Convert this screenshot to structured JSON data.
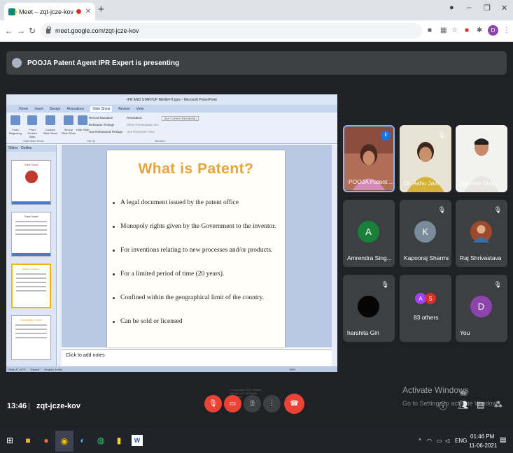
{
  "browser": {
    "tab_title": "Meet – zqt-jcze-kov",
    "close_tab": "✕",
    "new_tab": "+",
    "url": "meet.google.com/zqt-jcze-kov",
    "profile_initial": "D",
    "window_controls": [
      "–",
      "❐",
      "✕"
    ]
  },
  "banner": {
    "text": "POOJA Patent Agent IPR Expert is presenting"
  },
  "presentation": {
    "window_title": "IPR AND STARTUP BENEFIT.pptx - Microsoft PowerPoint",
    "ribbon_tabs": [
      "Home",
      "Insert",
      "Design",
      "Animations",
      "Slide Show",
      "Review",
      "View"
    ],
    "ribbon_buttons": [
      "From Beginning",
      "From Current Slide",
      "Custom Slide Show",
      "Set Up Slide Show",
      "Hide Slide"
    ],
    "ribbon_options": [
      "Record Narration",
      "Rehearse Timings",
      "Use Rehearsed Timings",
      "Resolution:",
      "Use Current Resolution",
      "Show Presentation On:",
      "Use Presenter View"
    ],
    "ribbon_groups": [
      "Start Slide Show",
      "Set Up",
      "Monitors"
    ],
    "panel_tabs": [
      "Slides",
      "Outline"
    ],
    "thumbnails": [
      "Trade Secret",
      "Trade Secret",
      "What is Patent?",
      "Patentability Criteria"
    ],
    "slide": {
      "title": "What is Patent?",
      "bullets": [
        "A legal document issued by the patent office",
        "Monopoly rights given by the Government to the inventor.",
        "For inventions relating to new processes and/or products.",
        "For a limited period of time (20 years).",
        "Confined within the geographical limit of the country.",
        "Can be sold or licensed"
      ],
      "copyright": "© Copyright 2020 Vahinie Shinde LLP. All Rights Reserved"
    },
    "notes_placeholder": "Click to add notes",
    "status": [
      "Slide 47 of 79",
      "\"Aspect\"",
      "English (India)",
      "66%"
    ]
  },
  "participants": [
    {
      "name": "POOJA Patent ...",
      "type": "photo",
      "active": true
    },
    {
      "name": "Dr. Ashu Jain",
      "type": "photo"
    },
    {
      "name": "Agarwal Shiv...",
      "type": "photo"
    },
    {
      "name": "Amrendra Sing...",
      "initial": "A",
      "color": "#188038"
    },
    {
      "name": "Kapooraj Sharma",
      "initial": "K",
      "color": "#7a8b9b"
    },
    {
      "name": "Raj Shrivastava",
      "type": "photo"
    },
    {
      "name": "harshita Giri",
      "type": "photo"
    },
    {
      "name": "83 others",
      "initials": [
        "A",
        "S"
      ]
    },
    {
      "name": "You",
      "initial": "D",
      "color": "#8e44ad"
    }
  ],
  "watermark": {
    "line1": "Activate Windows",
    "line2": "Go to Settings to activate Windows."
  },
  "meeting": {
    "time": "13:46",
    "separator": "|",
    "code": "zqt-jcze-kov",
    "participant_count": "92"
  },
  "taskbar": {
    "language": "ENG",
    "clock_time": "01:46 PM",
    "clock_date": "11-06-2021"
  }
}
